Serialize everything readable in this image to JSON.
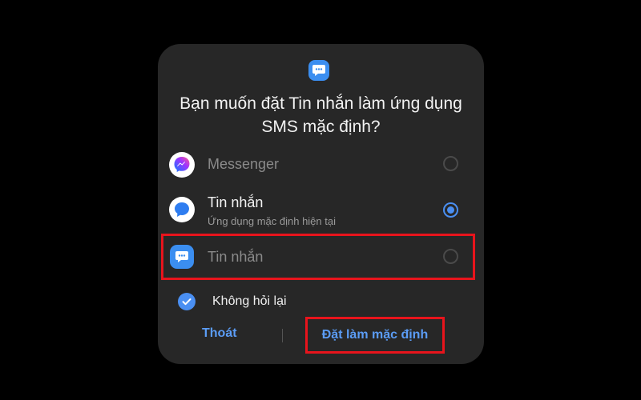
{
  "dialog": {
    "title": "Bạn muốn đặt Tin nhắn làm ứng dụng SMS mặc định?",
    "app_icon": "chat-bubble-icon"
  },
  "options": [
    {
      "label": "Messenger",
      "sublabel": "",
      "icon": "messenger-icon",
      "selected": false,
      "enabled": false
    },
    {
      "label": "Tin nhắn",
      "sublabel": "Ứng dụng mặc định hiện tại",
      "icon": "samsung-messages-icon",
      "selected": true,
      "enabled": true
    },
    {
      "label": "Tin nhắn",
      "sublabel": "",
      "icon": "chat-bubble-icon",
      "selected": false,
      "enabled": false
    }
  ],
  "dont_ask": {
    "label": "Không hỏi lại",
    "checked": true
  },
  "buttons": {
    "exit_label": "Thoát",
    "set_default_label": "Đặt làm mặc định"
  },
  "colors": {
    "accent": "#4a8ff2",
    "highlight": "#e8141c",
    "dialog_bg": "#272727"
  }
}
